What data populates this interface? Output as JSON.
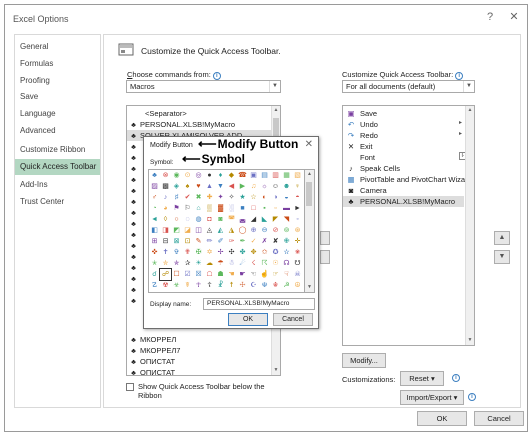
{
  "window": {
    "title": "Excel Options",
    "help": "?",
    "close": "✕"
  },
  "nav": {
    "items": [
      "General",
      "Formulas",
      "Proofing",
      "Save",
      "Language",
      "Advanced",
      "Customize Ribbon",
      "Quick Access Toolbar",
      "Add-Ins",
      "Trust Center"
    ],
    "selected": "Quick Access Toolbar"
  },
  "header": {
    "title": "Customize the Quick Access Toolbar."
  },
  "left": {
    "choose_label_underline": "C",
    "choose_label": "hoose commands from:",
    "choose_value": "Macros",
    "commands": [
      "<Separator>",
      "PERSONAL.XLSB!MyMacro",
      "SOLVER.XLAM!SOLVER.ADD",
      "",
      "",
      "",
      "",
      "",
      "",
      "",
      "",
      "",
      "",
      "",
      "",
      "",
      "",
      "",
      "МКОРРЕЛ",
      "МКОРРЕЛ7",
      "ОПИСТАТ",
      "ОПИСТАТ"
    ],
    "show_below_text": "Show Quick Access Toolbar below the Ribbon"
  },
  "right": {
    "customize_label": "Customize Quick Access Toolbar:",
    "customize_value": "For all documents (default)",
    "items": [
      {
        "icon": "save",
        "label": "Save",
        "has_sub": false
      },
      {
        "icon": "undo",
        "label": "Undo",
        "has_sub": true
      },
      {
        "icon": "redo",
        "label": "Redo",
        "has_sub": true
      },
      {
        "icon": "exit",
        "label": "Exit",
        "has_sub": false
      },
      {
        "icon": "font",
        "label": "Font",
        "has_sub": true
      },
      {
        "icon": "speak",
        "label": "Speak Cells",
        "has_sub": false
      },
      {
        "icon": "pivot",
        "label": "PivotTable and PivotChart Wizard",
        "has_sub": false
      },
      {
        "icon": "camera",
        "label": "Camera",
        "has_sub": false
      },
      {
        "icon": "macro",
        "label": "PERSONAL.XLSB!MyMacro",
        "has_sub": false
      }
    ],
    "modify_label": "Modify...",
    "customizations_label": "Customizations:",
    "reset_label": "Reset ▾",
    "import_export_label": "Import/Export ▾"
  },
  "footer": {
    "ok": "OK",
    "cancel": "Cancel"
  },
  "modify_dialog": {
    "title": "Modify Button",
    "symbol_label": "Symbol:",
    "display_name_label": "Display name:",
    "display_name_value": "PERSONAL.XLSB!MyMacro",
    "ok": "OK",
    "cancel": "Cancel"
  },
  "annotations": {
    "modify_button": "Modify Button",
    "symbol": "Symbol"
  },
  "colors": {
    "nav_selected": "#b3d7c2",
    "accent": "#3c7fc0"
  }
}
